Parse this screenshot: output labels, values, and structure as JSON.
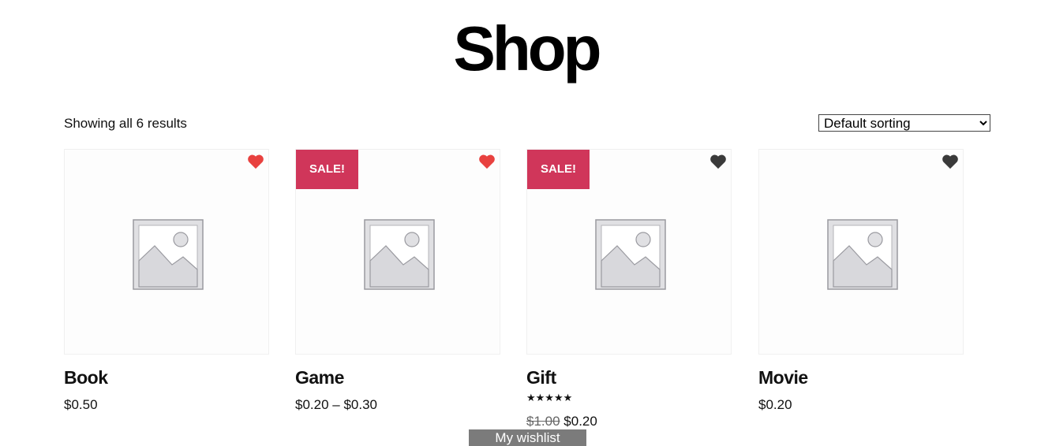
{
  "page": {
    "title": "Shop",
    "result_count": "Showing all 6 results",
    "sorting": {
      "selected": "Default sorting",
      "options": [
        "Default sorting"
      ]
    }
  },
  "colors": {
    "sale_badge": "#d0365a",
    "heart_active": "#e8413f",
    "heart_inactive": "#3a3a3a",
    "wishlist_bar": "#7b7b7b"
  },
  "products": [
    {
      "name": "Book",
      "price": "$0.50",
      "sale": false,
      "sale_label": "",
      "wishlisted": true,
      "icon": "image-placeholder-icon"
    },
    {
      "name": "Game",
      "price": "$0.20 – $0.30",
      "sale": true,
      "sale_label": "SALE!",
      "wishlisted": true,
      "icon": "image-placeholder-icon"
    },
    {
      "name": "Gift",
      "regular_price": "$1.00",
      "price": "$0.20",
      "sale": true,
      "sale_label": "SALE!",
      "wishlisted": false,
      "rating_stars": "★★★★★",
      "rating_value": 5,
      "icon": "image-placeholder-icon"
    },
    {
      "name": "Movie",
      "price": "$0.20",
      "sale": false,
      "sale_label": "",
      "wishlisted": false,
      "icon": "image-placeholder-icon"
    }
  ],
  "wishlist_bar": {
    "label": "My wishlist"
  }
}
